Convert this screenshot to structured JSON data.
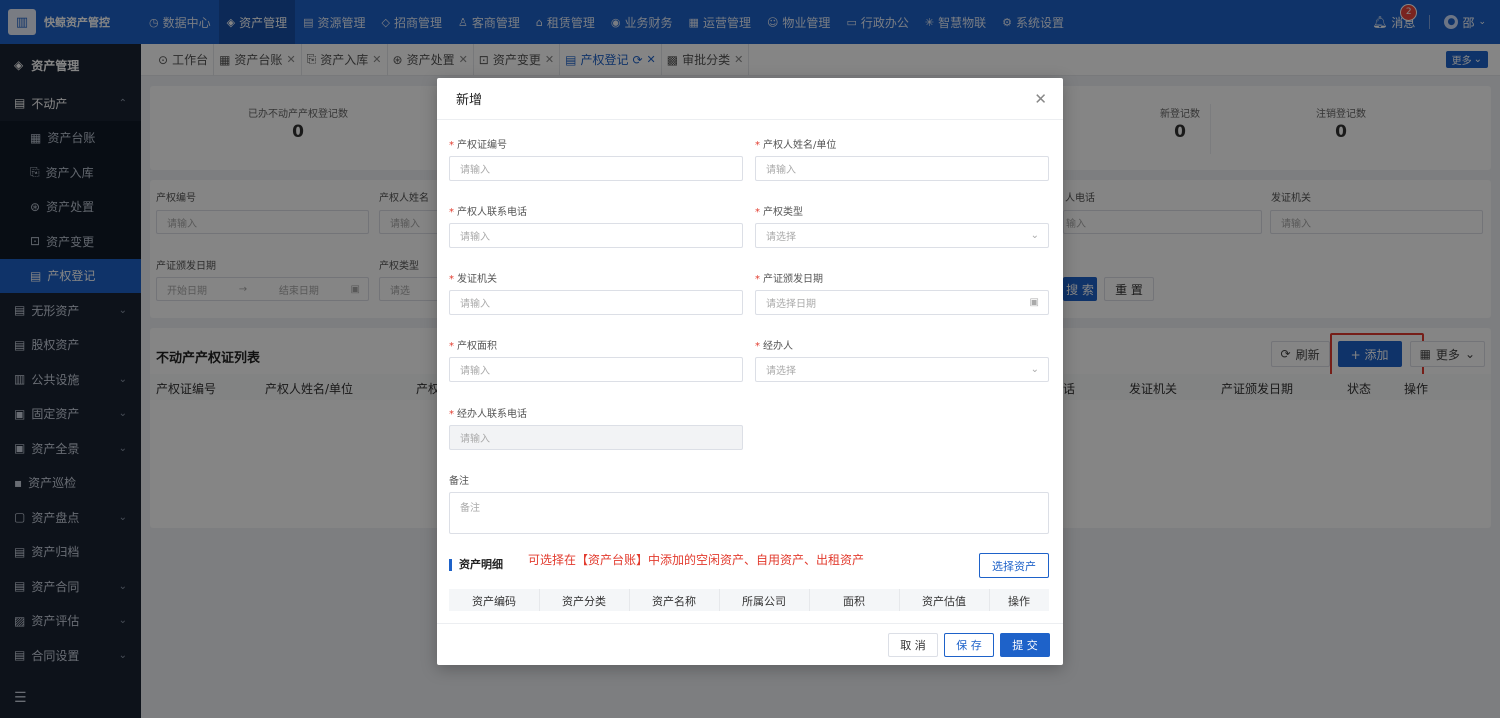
{
  "brand": {
    "name": "快鲸资产管控",
    "logo_glyph": "▥"
  },
  "topnav": [
    {
      "label": "数据中心",
      "icon": "clock-icon",
      "glyph": "◷"
    },
    {
      "label": "资产管理",
      "icon": "box-icon",
      "glyph": "◈",
      "active": true
    },
    {
      "label": "资源管理",
      "icon": "building-icon",
      "glyph": "▤"
    },
    {
      "label": "招商管理",
      "icon": "tag-icon",
      "glyph": "◇"
    },
    {
      "label": "客商管理",
      "icon": "users-icon",
      "glyph": "♙"
    },
    {
      "label": "租赁管理",
      "icon": "home-icon",
      "glyph": "⌂"
    },
    {
      "label": "业务财务",
      "icon": "coin-icon",
      "glyph": "◉"
    },
    {
      "label": "运营管理",
      "icon": "grid-icon",
      "glyph": "▦"
    },
    {
      "label": "物业管理",
      "icon": "smile-icon",
      "glyph": "☺"
    },
    {
      "label": "行政办公",
      "icon": "monitor-icon",
      "glyph": "▭"
    },
    {
      "label": "智慧物联",
      "icon": "iot-icon",
      "glyph": "✳"
    },
    {
      "label": "系统设置",
      "icon": "gear-icon",
      "glyph": "⚙"
    }
  ],
  "header_right": {
    "message_label": "消息",
    "message_count": "2",
    "user_name": "邵"
  },
  "sidebar": {
    "title": "资产管理",
    "group_realestate": "不动产",
    "sub_items": [
      {
        "label": "资产台账",
        "glyph": "▦"
      },
      {
        "label": "资产入库",
        "glyph": "⎘"
      },
      {
        "label": "资产处置",
        "glyph": "⊛"
      },
      {
        "label": "资产变更",
        "glyph": "⊡"
      },
      {
        "label": "产权登记",
        "glyph": "▤",
        "active": true
      }
    ],
    "items": [
      {
        "label": "无形资产",
        "glyph": "▤",
        "chev": true
      },
      {
        "label": "股权资产",
        "glyph": "▤",
        "chev": false
      },
      {
        "label": "公共设施",
        "glyph": "▥",
        "chev": true
      },
      {
        "label": "固定资产",
        "glyph": "▣",
        "chev": true
      },
      {
        "label": "资产全景",
        "glyph": "▣",
        "chev": true
      },
      {
        "label": "资产巡检",
        "glyph": "▪",
        "chev": false
      },
      {
        "label": "资产盘点",
        "glyph": "▢",
        "chev": true
      },
      {
        "label": "资产归档",
        "glyph": "▤",
        "chev": false
      },
      {
        "label": "资产合同",
        "glyph": "▤",
        "chev": true
      },
      {
        "label": "资产评估",
        "glyph": "▨",
        "chev": true
      },
      {
        "label": "合同设置",
        "glyph": "▤",
        "chev": true
      }
    ],
    "collapse_glyph": "☰"
  },
  "tabs": [
    {
      "label": "工作台",
      "glyph": "⊙",
      "closable": false
    },
    {
      "label": "资产台账",
      "glyph": "▦",
      "closable": true
    },
    {
      "label": "资产入库",
      "glyph": "⎘",
      "closable": true
    },
    {
      "label": "资产处置",
      "glyph": "⊛",
      "closable": true
    },
    {
      "label": "资产变更",
      "glyph": "⊡",
      "closable": true
    },
    {
      "label": "产权登记",
      "glyph": "▤",
      "closable": true,
      "active": true
    },
    {
      "label": "审批分类",
      "glyph": "▩",
      "closable": true
    }
  ],
  "tabs_more": "更多",
  "stats": [
    {
      "label": "已办不动产产权登记数",
      "value": "0"
    },
    {
      "label": "新登记数",
      "value": "0"
    },
    {
      "label": "注销登记数",
      "value": "0"
    }
  ],
  "search": {
    "f1_label": "产权编号",
    "f1_placeholder": "请输入",
    "f2_label": "产权人姓名",
    "f2_placeholder": "请输入",
    "f3_label": "人电话",
    "f3_placeholder": "输入",
    "f4_label": "发证机关",
    "f4_placeholder": "请输入",
    "f5_label": "产证颁发日期",
    "f5_start": "开始日期",
    "f5_sep": "→",
    "f5_end": "结束日期",
    "f6_label": "产权类型",
    "f6_placeholder": "请选",
    "search_btn": "搜 索",
    "reset_btn": "重 置"
  },
  "list": {
    "title": "不动产产权证列表",
    "refresh": "刷新",
    "add": "+ 添加",
    "more": "更多",
    "columns_left": [
      "产权证编号",
      "产权人姓名/单位",
      "产权"
    ],
    "columns_right": [
      "话",
      "发证机关",
      "产证颁发日期",
      "状态",
      "操作"
    ]
  },
  "modal": {
    "title": "新增",
    "fields": {
      "cert_no_label": "产权证编号",
      "cert_no_placeholder": "请输入",
      "owner_label": "产权人姓名/单位",
      "owner_placeholder": "请输入",
      "owner_phone_label": "产权人联系电话",
      "owner_phone_placeholder": "请输入",
      "type_label": "产权类型",
      "type_placeholder": "请选择",
      "issuer_label": "发证机关",
      "issuer_placeholder": "请输入",
      "issue_date_label": "产证颁发日期",
      "issue_date_placeholder": "请选择日期",
      "area_label": "产权面积",
      "area_placeholder": "请输入",
      "handler_label": "经办人",
      "handler_placeholder": "请选择",
      "handler_phone_label": "经办人联系电话",
      "handler_phone_placeholder": "请输入",
      "remark_label": "备注",
      "remark_placeholder": "备注"
    },
    "asset_section_title": "资产明细",
    "asset_hint": "可选择在【资产台账】中添加的空闲资产、自用资产、出租资产",
    "select_asset_btn": "选择资产",
    "asset_columns": [
      "资产编码",
      "资产分类",
      "资产名称",
      "所属公司",
      "面积",
      "资产估值",
      "操作"
    ],
    "cancel": "取 消",
    "save": "保 存",
    "submit": "提 交"
  }
}
